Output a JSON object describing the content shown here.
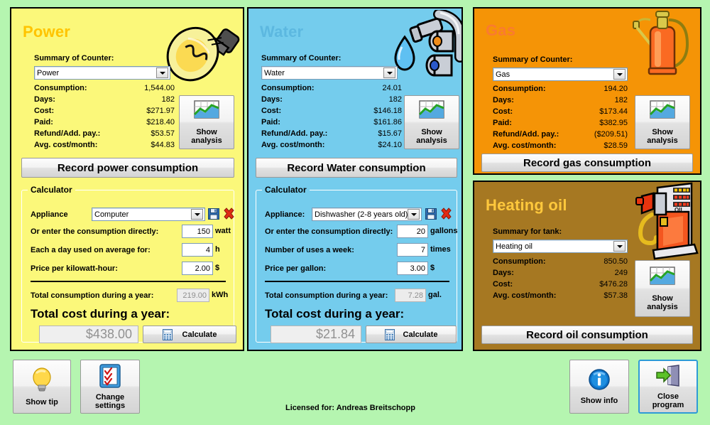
{
  "app": {
    "background_color": "#b5f5b0",
    "license_text": "Licensed for: Andreas Breitschopp"
  },
  "panels": {
    "power": {
      "title": "Power",
      "accent_color": "#ffc400",
      "bg_color": "#fbf87a",
      "icon": "lightbulb-icon",
      "summary_label": "Summary of Counter:",
      "counter_selected": "Power",
      "rows": [
        {
          "label": "Consumption:",
          "value": "1,544.00"
        },
        {
          "label": "Days:",
          "value": "182"
        },
        {
          "label": "Cost:",
          "value": "$271.97"
        },
        {
          "label": "Paid:",
          "value": "$218.40"
        },
        {
          "label": "Refund/Add. pay.:",
          "value": "$53.57"
        },
        {
          "label": "Avg. cost/month:",
          "value": "$44.83"
        }
      ],
      "analysis_button": {
        "line1": "Show",
        "line2": "analysis"
      },
      "record_button": "Record power consumption",
      "calculator": {
        "caption": "Calculator",
        "appliance_label": "Appliance",
        "appliance_selected": "Computer",
        "save_icon": "save-icon",
        "delete_icon": "delete-icon",
        "fields": [
          {
            "label": "Or enter the consumption directly:",
            "value": "150",
            "unit": "watt"
          },
          {
            "label": "Each a day used on average for:",
            "value": "4",
            "unit": "h"
          },
          {
            "label": "Price per kilowatt-hour:",
            "value": "2.00",
            "unit": "$"
          }
        ],
        "total_consumption_label": "Total consumption during a year:",
        "total_consumption_value": "219.00",
        "total_consumption_unit": "kWh",
        "total_cost_label": "Total cost during a year:",
        "total_cost_value": "$438.00",
        "calculate_button": "Calculate",
        "calculate_icon": "calculator-icon"
      }
    },
    "water": {
      "title": "Water",
      "accent_color": "#5cb8e0",
      "bg_color": "#74cced",
      "icon": "faucet-icon",
      "summary_label": "Summary of Counter:",
      "counter_selected": "Water",
      "rows": [
        {
          "label": "Consumption:",
          "value": "24.01"
        },
        {
          "label": "Days:",
          "value": "182"
        },
        {
          "label": "Cost:",
          "value": "$146.18"
        },
        {
          "label": "Paid:",
          "value": "$161.86"
        },
        {
          "label": "Refund/Add. pay.:",
          "value": "$15.67"
        },
        {
          "label": "Avg. cost/month:",
          "value": "$24.10"
        }
      ],
      "analysis_button": {
        "line1": "Show",
        "line2": "analysis"
      },
      "record_button": "Record Water consumption",
      "calculator": {
        "caption": "Calculator",
        "appliance_label": "Appliance:",
        "appliance_selected": "Dishwasher (2-8 years old)",
        "save_icon": "save-icon",
        "delete_icon": "delete-icon",
        "fields": [
          {
            "label": "Or enter the consumption directly:",
            "value": "20",
            "unit": "gallons"
          },
          {
            "label": "Number of uses a week:",
            "value": "7",
            "unit": "times"
          },
          {
            "label": "Price per gallon:",
            "value": "3.00",
            "unit": "$"
          }
        ],
        "total_consumption_label": "Total consumption during a year:",
        "total_consumption_value": "7.28",
        "total_consumption_unit": "gal.",
        "total_cost_label": "Total cost during a year:",
        "total_cost_value": "$21.84",
        "calculate_button": "Calculate",
        "calculate_icon": "calculator-icon"
      }
    },
    "gas": {
      "title": "Gas",
      "accent_color": "#fa7b30",
      "bg_color": "#f59406",
      "icon": "gas-bottle-icon",
      "summary_label": "Summary of Counter:",
      "counter_selected": "Gas",
      "rows": [
        {
          "label": "Consumption:",
          "value": "194.20"
        },
        {
          "label": "Days:",
          "value": "182"
        },
        {
          "label": "Cost:",
          "value": "$173.44"
        },
        {
          "label": "Paid:",
          "value": "$382.95"
        },
        {
          "label": "Refund/Add. pay.:",
          "value": "($209.51)"
        },
        {
          "label": "Avg. cost/month:",
          "value": "$28.59"
        }
      ],
      "analysis_button": {
        "line1": "Show",
        "line2": "analysis"
      },
      "record_button": "Record gas consumption"
    },
    "oil": {
      "title": "Heating oil",
      "accent_color": "#ffc83c",
      "bg_color": "#a67822",
      "icon": "fuel-pump-icon",
      "summary_label": "Summary for tank:",
      "counter_selected": "Heating oil",
      "rows": [
        {
          "label": "Consumption:",
          "value": "850.50"
        },
        {
          "label": "Days:",
          "value": "249"
        },
        {
          "label": "Cost:",
          "value": "$476.28"
        },
        {
          "label": "Avg. cost/month:",
          "value": "$57.38"
        }
      ],
      "analysis_button": {
        "line1": "Show",
        "line2": "analysis"
      },
      "record_button": "Record oil consumption"
    }
  },
  "footer": {
    "show_tip": {
      "label": "Show tip",
      "icon": "lightbulb-icon"
    },
    "change_settings": {
      "line1": "Change",
      "line2": "settings",
      "icon": "checklist-icon"
    },
    "show_info": {
      "label": "Show info",
      "icon": "info-icon"
    },
    "close_program": {
      "line1": "Close",
      "line2": "program",
      "icon": "exit-door-icon"
    }
  }
}
